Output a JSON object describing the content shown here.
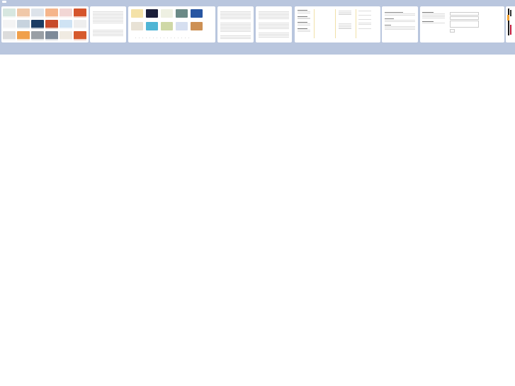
{
  "nav": {
    "items": [
      "",
      "",
      "",
      "",
      "",
      ""
    ]
  },
  "panels": {
    "p1": {
      "title": "",
      "thumbs": [
        "#d7e7e0",
        "#f0c8a8",
        "#dde3ea",
        "#f5b58b",
        "#f2d6d4",
        "#d5542c",
        "#f4f4f4",
        "#c7d3de",
        "#1b3c63",
        "#c84b2b",
        "#cfe3f4",
        "#eeeeee",
        "#dcdcdc",
        "#f0a04b",
        "#999fa5",
        "#7d8a99",
        "#f0ebe2",
        "#d65a2d"
      ]
    },
    "p4": {
      "thumbs": [
        "#f4e2a8",
        "#1c1f3a",
        "#eef0e2",
        "#6b8a87",
        "#2856a2",
        "#e8e2d5",
        "#4fb5d5",
        "#cfd8a6",
        "#d6dff0",
        "#cd9054"
      ]
    },
    "p9": {
      "buttonLabel": ""
    }
  }
}
